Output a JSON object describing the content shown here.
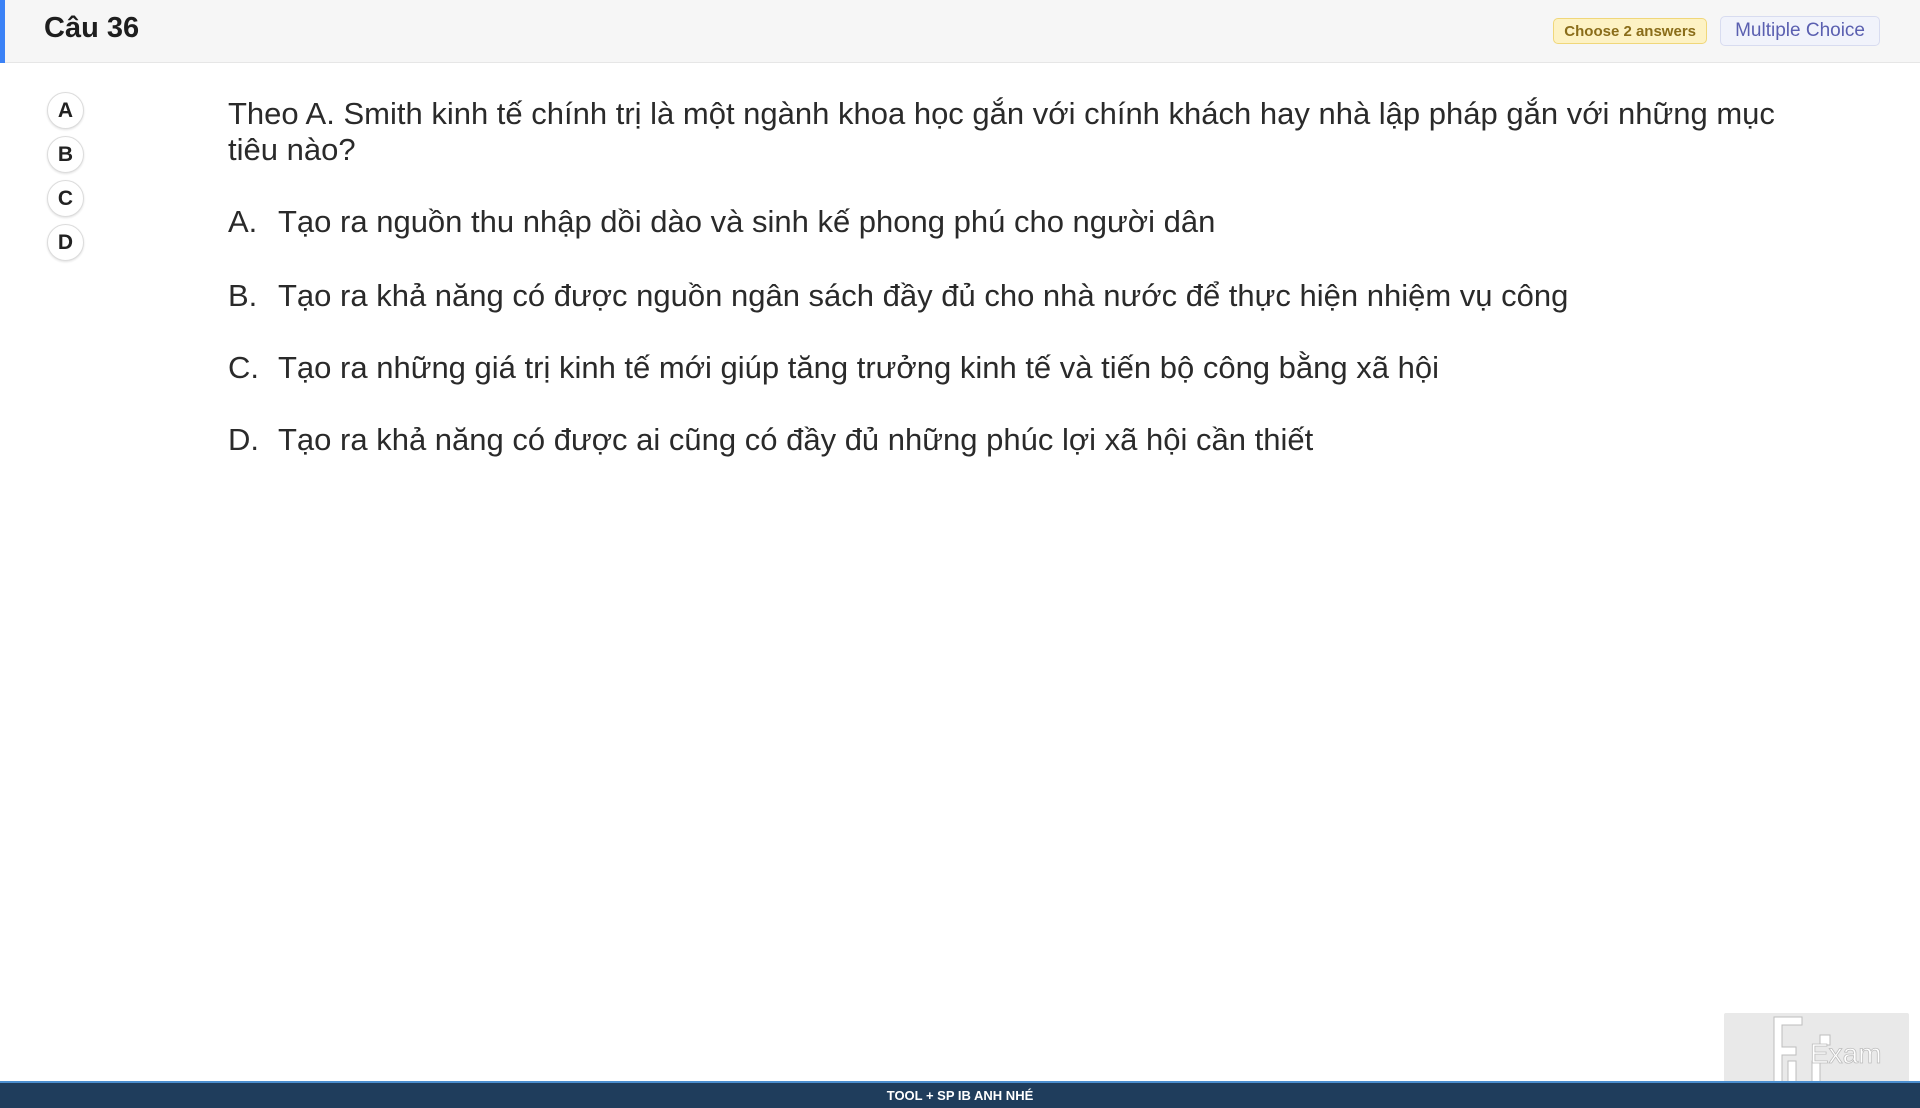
{
  "header": {
    "title": "Câu 36",
    "badge_choose": "Choose 2 answers",
    "badge_type": "Multiple Choice",
    "accent_color": "#3b82f6"
  },
  "answer_selector": {
    "buttons": [
      "A",
      "B",
      "C",
      "D"
    ]
  },
  "question": {
    "text": "Theo A. Smith kinh tế chính trị là một ngành khoa học gắn với chính khách hay nhà lập pháp gắn với những mục tiêu nào?",
    "options": [
      {
        "letter": "A.",
        "text": "Tạo ra nguồn thu nhập dồi dào và sinh kế phong phú cho người dân"
      },
      {
        "letter": "B.",
        "text": "Tạo ra khả năng có được nguồn ngân sách đầy đủ cho nhà nước để thực hiện nhiệm vụ công"
      },
      {
        "letter": "C.",
        "text": "Tạo ra những giá trị kinh tế mới giúp tăng trưởng kinh tế và tiến bộ công bằng xã hội"
      },
      {
        "letter": "D.",
        "text": "Tạo ra khả năng có được ai cũng có đầy đủ những phúc lợi xã hội cần thiết"
      }
    ]
  },
  "logo": {
    "text": "Exam",
    "icon": "fu-exam-logo"
  },
  "footer": {
    "text": "TOOL + SP IB ANH NHÉ",
    "color": "#1f3d5c"
  }
}
